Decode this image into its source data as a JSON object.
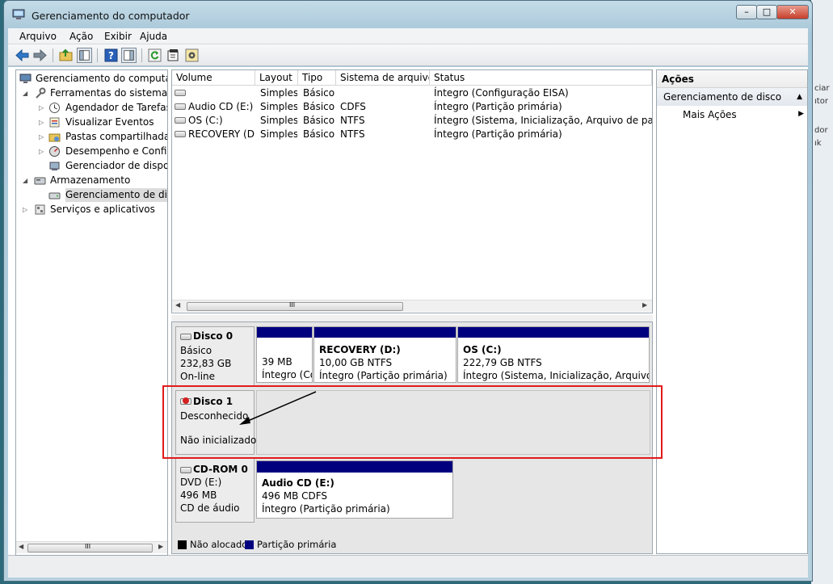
{
  "window": {
    "title": "Gerenciamento do computador",
    "min": "–",
    "max": "□",
    "close": "✕"
  },
  "menu": [
    "Arquivo",
    "Ação",
    "Exibir",
    "Ajuda"
  ],
  "tree": {
    "root": "Gerenciamento do computador",
    "items": [
      "Ferramentas do sistema",
      "Agendador de Tarefas",
      "Visualizar Eventos",
      "Pastas compartilhadas",
      "Desempenho e Confiabilidade",
      "Gerenciador de dispositivos",
      "Armazenamento",
      "Gerenciamento de disco",
      "Serviços e aplicativos"
    ],
    "scroll_grip": "III"
  },
  "volumes": {
    "columns": [
      "Volume",
      "Layout",
      "Tipo",
      "Sistema de arquivos",
      "Status"
    ],
    "rows": [
      [
        "",
        "Simples",
        "Básico",
        "",
        "Íntegro (Configuração EISA)"
      ],
      [
        "Audio CD (E:)",
        "Simples",
        "Básico",
        "CDFS",
        "Íntegro (Partição primária)"
      ],
      [
        "OS (C:)",
        "Simples",
        "Básico",
        "NTFS",
        "Íntegro (Sistema, Inicialização, Arquivo de paginação"
      ],
      [
        "RECOVERY (D:)",
        "Simples",
        "Básico",
        "NTFS",
        "Íntegro (Partição primária)"
      ]
    ],
    "scroll_grip": "III"
  },
  "disks": {
    "disk0": {
      "name": "Disco 0",
      "type": "Básico",
      "size": "232,83 GB",
      "state": "On-line",
      "partitions": [
        {
          "name": "",
          "size": "39 MB",
          "status": "Íntegro (Configuração EISA)"
        },
        {
          "name": "RECOVERY  (D:)",
          "size": "10,00 GB NTFS",
          "status": "Íntegro (Partição primária)"
        },
        {
          "name": "OS  (C:)",
          "size": "222,79 GB NTFS",
          "status": "Íntegro (Sistema, Inicialização, Arquivo de paginação)"
        }
      ]
    },
    "disk1": {
      "name": "Disco 1",
      "type": "Desconhecido",
      "state": "Não inicializado"
    },
    "cdrom0": {
      "name": "CD-ROM 0",
      "type": "DVD (E:)",
      "size": "496 MB",
      "state": "CD de áudio",
      "partition": {
        "name": "Audio CD  (E:)",
        "size": "496 MB CDFS",
        "status": "Íntegro (Partição primária)"
      }
    }
  },
  "legend": {
    "unallocated": "Não alocado",
    "primary": "Partição primária"
  },
  "actions": {
    "header": "Ações",
    "section": "Gerenciamento de disco",
    "more": "Mais Ações"
  },
  "background_window": {
    "line1": "ciar",
    "line2": "ıtor",
    "line3": "dor",
    "line4": "ık"
  },
  "colors": {
    "partition_band": "#00007f",
    "highlight_box": "#e21b1b",
    "unallocated": "#000000"
  }
}
